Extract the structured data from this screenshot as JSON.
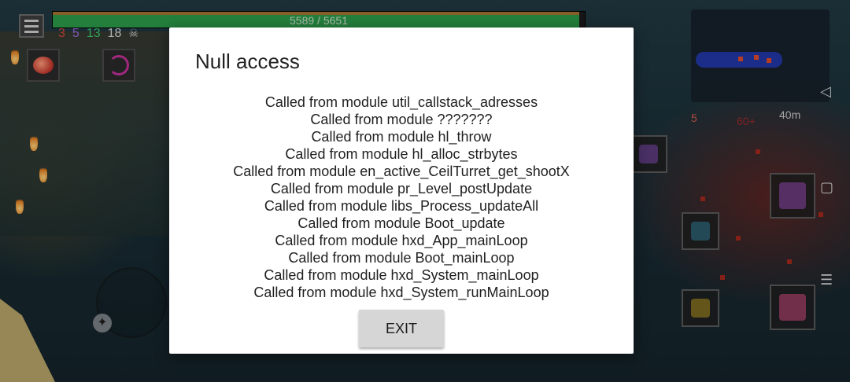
{
  "hud": {
    "health_text": "5589 / 5651",
    "health_fraction": 0.989,
    "stats": [
      "3",
      "5",
      "13",
      "18"
    ],
    "skull_icon": "skull-icon",
    "minimap_kill_count": "5",
    "minimap_timer": "40m",
    "minimap_extra": "60+",
    "colors": {
      "health": "#2d9b4a",
      "brutality": "#d2483b",
      "tactics": "#9f6ae0",
      "survival": "#3cc46b"
    }
  },
  "nav": {
    "back_icon": "back-triangle-icon",
    "home_icon": "home-square-icon",
    "menu_icon": "hamburger-icon"
  },
  "dialog": {
    "title": "Null access",
    "stack_lines": [
      "Called from module util_callstack_adresses",
      "Called from module ???????",
      "Called from module hl_throw",
      "Called from module hl_alloc_strbytes",
      "Called from module en_active_CeilTurret_get_shootX",
      "Called from module pr_Level_postUpdate",
      "Called from module libs_Process_updateAll",
      "Called from module Boot_update",
      "Called from module hxd_App_mainLoop",
      "Called from module Boot_mainLoop",
      "Called from module hxd_System_mainLoop",
      "Called from module hxd_System_runMainLoop"
    ],
    "exit_label": "EXIT"
  }
}
